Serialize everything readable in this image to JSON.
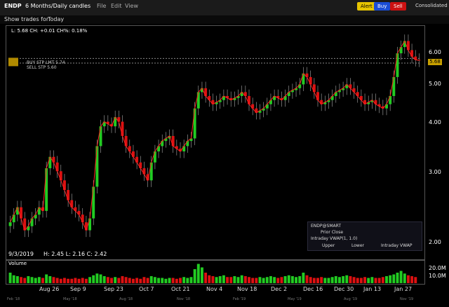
{
  "header": {
    "symbol": "ENDP",
    "period": "6 Months/Daily candles",
    "menus": [
      "File",
      "Edit",
      "View"
    ],
    "alert_label": "Alert",
    "buy_label": "Buy",
    "sell_label": "Sell",
    "consolidated_label": "Consolidated"
  },
  "subbar": {
    "show_trades_label": "Show trades for:",
    "show_trades_value": "Today"
  },
  "info": {
    "quote_line": "L: 5.68 CH: +0.01 CH%: 0.18%",
    "date_line": "9/3/2019",
    "hlc_line": "H: 2.45  L: 2.16  C: 2.42"
  },
  "orders": {
    "buy": "BUY STP LMT 5.74",
    "sell": "SELL STP 5.60",
    "price_tag": "5.68"
  },
  "legend": {
    "title": "ENDP@SMART",
    "prior_close": "Prior Close",
    "vwap": "Intraday VWAP(1, 1.0)",
    "upper": "Upper",
    "lower": "Lower",
    "intraday_vwap": "Intraday VWAP"
  },
  "y_axis": [
    "6.00",
    "5.00",
    "4.00",
    "3.00",
    "2.00"
  ],
  "x_axis": [
    "Aug 26",
    "Sep 9",
    "Sep 23",
    "Oct 7",
    "Oct 21",
    "Nov 4",
    "Nov 18",
    "Dec 2",
    "Dec 16",
    "Dec 30",
    "Jan 13",
    "Jan 27"
  ],
  "volume": {
    "label": "Volume",
    "axis": [
      "20.0M",
      "10.0M"
    ]
  },
  "mini_axis": [
    "Feb '18",
    "May '18",
    "Aug '18",
    "Nov '18",
    "Feb '19",
    "May '19",
    "Aug '19",
    "Nov '19"
  ],
  "colors": {
    "up": "#22cc22",
    "down": "#dd1111",
    "ma": "#ff2222",
    "bg": "#000000"
  },
  "chart_data": {
    "type": "candlestick",
    "title": "ENDP",
    "ylim": [
      2.0,
      6.6
    ],
    "log_scale": true,
    "closes": [
      2.4,
      2.5,
      2.6,
      2.45,
      2.3,
      2.35,
      2.45,
      2.5,
      2.6,
      2.55,
      3.2,
      3.4,
      3.3,
      3.15,
      3.0,
      2.85,
      2.7,
      2.6,
      2.55,
      2.5,
      2.4,
      2.3,
      2.45,
      2.9,
      3.6,
      4.0,
      4.1,
      4.05,
      4.0,
      4.2,
      4.1,
      3.8,
      3.6,
      3.5,
      3.4,
      3.3,
      3.2,
      3.1,
      3.0,
      3.3,
      3.5,
      3.6,
      3.7,
      3.75,
      3.8,
      3.6,
      3.55,
      3.5,
      3.6,
      3.7,
      3.75,
      4.4,
      4.8,
      4.9,
      4.7,
      4.6,
      4.5,
      4.55,
      4.6,
      4.7,
      4.65,
      4.6,
      4.65,
      4.7,
      4.8,
      4.7,
      4.5,
      4.4,
      4.3,
      4.35,
      4.4,
      4.5,
      4.6,
      4.7,
      4.65,
      4.6,
      4.7,
      4.8,
      4.85,
      4.9,
      5.0,
      5.3,
      5.2,
      5.0,
      4.8,
      4.6,
      4.5,
      4.55,
      4.6,
      4.7,
      4.8,
      4.85,
      4.9,
      5.0,
      4.9,
      4.8,
      4.7,
      4.6,
      4.5,
      4.55,
      4.6,
      4.5,
      4.45,
      4.4,
      4.5,
      4.7,
      5.2,
      5.9,
      6.1,
      6.3,
      6.0,
      5.8,
      5.7,
      5.68
    ],
    "volume": [
      12,
      9,
      8,
      7,
      6,
      8,
      7,
      6,
      7,
      6,
      10,
      8,
      7,
      6,
      5,
      6,
      5,
      5,
      6,
      5,
      6,
      5,
      7,
      9,
      11,
      10,
      8,
      7,
      6,
      7,
      6,
      8,
      7,
      6,
      5,
      6,
      5,
      7,
      6,
      8,
      7,
      6,
      6,
      5,
      6,
      6,
      5,
      6,
      7,
      6,
      7,
      16,
      22,
      18,
      12,
      9,
      8,
      7,
      8,
      9,
      7,
      7,
      8,
      7,
      9,
      8,
      7,
      6,
      6,
      7,
      6,
      7,
      8,
      7,
      6,
      7,
      8,
      9,
      8,
      7,
      8,
      12,
      9,
      7,
      6,
      6,
      7,
      6,
      6,
      7,
      8,
      7,
      8,
      9,
      8,
      7,
      6,
      6,
      7,
      6,
      7,
      6,
      6,
      7,
      8,
      9,
      10,
      12,
      14,
      11,
      9,
      8,
      7
    ]
  }
}
